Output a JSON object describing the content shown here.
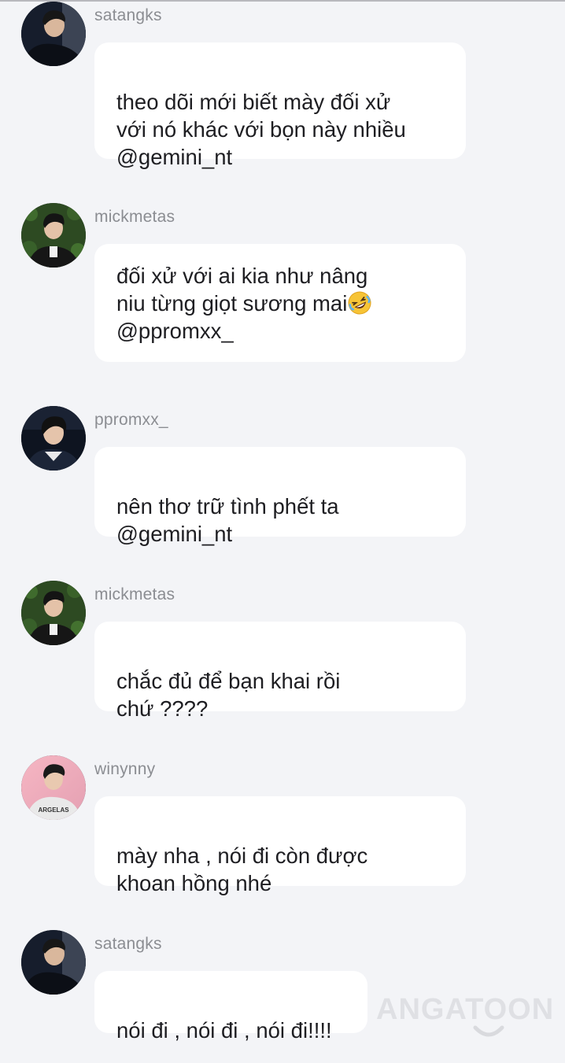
{
  "messages": [
    {
      "username": "satangks",
      "text": "theo dõi mới biết mày đối xử\nvới nó khác với bọn này nhiều\n@gemini_nt"
    },
    {
      "username": "mickmetas",
      "text": "đối xử với ai kia như nâng\nniu từng giọt sương mai",
      "emoji": "rolling-on-floor-laughing-emoji",
      "text_after": "\n@ppromxx_"
    },
    {
      "username": "ppromxx_",
      "text": "nên thơ trữ tình phết ta\n@gemini_nt"
    },
    {
      "username": "mickmetas",
      "text": "chắc đủ để bạn khai rồi\nchứ ????"
    },
    {
      "username": "winynny",
      "text": "mày nha , nói đi còn được\nkhoan hồng nhé",
      "shirt_text": "ARGELAS"
    },
    {
      "username": "satangks",
      "text": "nói đi , nói đi , nói đi!!!!"
    }
  ],
  "watermark": {
    "text": "ANGATOON"
  },
  "colors": {
    "background": "#f3f4f7",
    "bubble": "#ffffff",
    "username": "#8b8d92",
    "message_text": "#1e1e22",
    "watermark": "#d9dade"
  }
}
